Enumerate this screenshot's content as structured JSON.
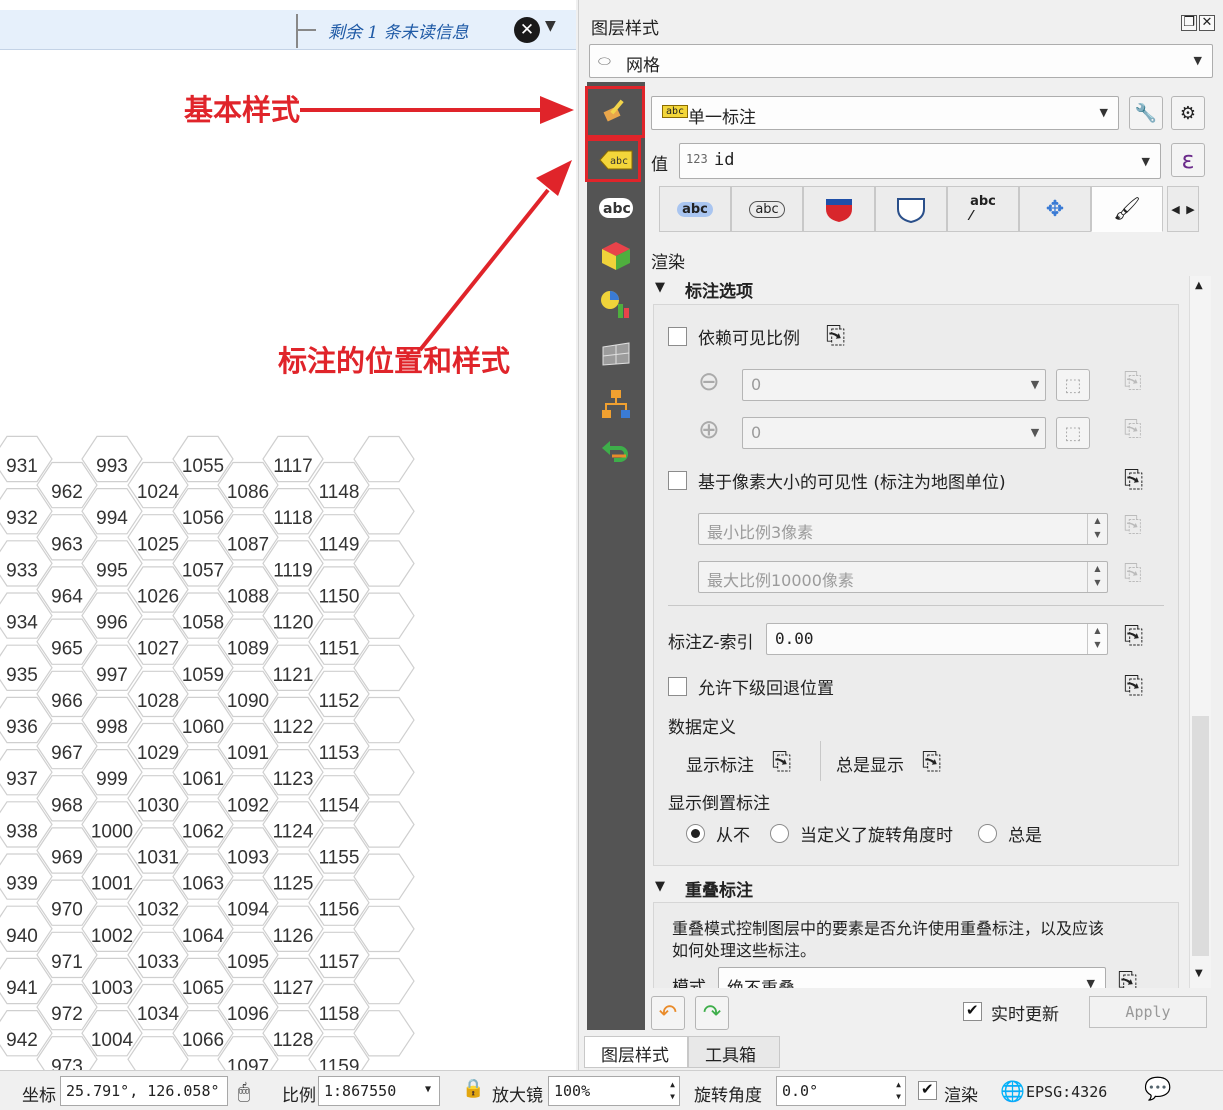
{
  "messagebar": {
    "text": "剩余 1 条未读信息"
  },
  "annotations": {
    "basic_style": "基本样式",
    "label_pos_style": "标注的位置和样式"
  },
  "hex_labels": [
    [
      "931",
      "993",
      "1055",
      "1117"
    ],
    [
      "962",
      "1024",
      "1086",
      "1148"
    ],
    [
      "932",
      "994",
      "1056",
      "1118"
    ],
    [
      "963",
      "1025",
      "1087",
      "1149"
    ],
    [
      "933",
      "995",
      "1057",
      "1119"
    ],
    [
      "964",
      "1026",
      "1088",
      "1150"
    ],
    [
      "934",
      "996",
      "1058",
      "1120"
    ],
    [
      "965",
      "1027",
      "1089",
      "1151"
    ],
    [
      "935",
      "997",
      "1059",
      "1121"
    ],
    [
      "966",
      "1028",
      "1090",
      "1152"
    ],
    [
      "936",
      "998",
      "1060",
      "1122"
    ],
    [
      "967",
      "1029",
      "1091",
      "1153"
    ],
    [
      "937",
      "999",
      "1061",
      "1123"
    ],
    [
      "968",
      "1030",
      "1092",
      "1154"
    ],
    [
      "938",
      "1000",
      "1062",
      "1124"
    ],
    [
      "969",
      "1031",
      "1093",
      "1155"
    ],
    [
      "939",
      "1001",
      "1063",
      "1125"
    ],
    [
      "970",
      "1032",
      "1094",
      "1156"
    ],
    [
      "940",
      "1002",
      "1064",
      "1126"
    ],
    [
      "971",
      "1033",
      "1095",
      "1157"
    ],
    [
      "941",
      "1003",
      "1065",
      "1127"
    ],
    [
      "972",
      "1034",
      "1096",
      "1158"
    ],
    [
      "942",
      "1004",
      "1066",
      "1128"
    ],
    [
      "973",
      "",
      "1097",
      "1159"
    ]
  ],
  "dock": {
    "title": "图层样式",
    "layer_combo": "网格",
    "renderer_combo": "单一标注",
    "value_label": "值",
    "value_prefix": "123",
    "value_field": "id",
    "epsilon": "ε",
    "tab_labels": [
      "abc",
      "abc",
      "abc"
    ],
    "page_title": "渲染",
    "label_options": {
      "title": "标注选项",
      "scale_vis": "依赖可见比例",
      "min_scale": "0",
      "max_scale": "0",
      "pixel_vis": "基于像素大小的可见性 (标注为地图单位)",
      "min_px": "最小比例3像素",
      "max_px": "最大比例10000像素",
      "z_index_label": "标注Z-索引",
      "z_index_value": "0.00",
      "fallback": "允许下级回退位置",
      "data_defined": "数据定义",
      "show_label": "显示标注",
      "always_show": "总是显示",
      "upside_down": "显示倒置标注",
      "radio_never": "从不",
      "radio_rot": "当定义了旋转角度时",
      "radio_always": "总是"
    },
    "overlap": {
      "title": "重叠标注",
      "desc1": "重叠模式控制图层中的要素是否允许使用重叠标注，以及应该",
      "desc2": "如何处理这些标注。",
      "mode_label": "模式",
      "mode_value": "绝不重叠"
    },
    "live_update": "实时更新",
    "apply": "Apply",
    "bottom_tabs": [
      "图层样式",
      "工具箱"
    ]
  },
  "status": {
    "coord_label": "坐标",
    "coord_value": "25.791°, 126.058°",
    "scale_label": "比例",
    "scale_value": "1:867550",
    "magnifier_label": "放大镜",
    "magnifier_value": "100%",
    "rotation_label": "旋转角度",
    "rotation_value": "0.0°",
    "render_label": "渲染",
    "crs": "EPSG:4326"
  },
  "colors": {
    "annotation_red": "#e0242a",
    "sidebar_dark": "#545454",
    "message_blue": "#1f5aa6"
  }
}
